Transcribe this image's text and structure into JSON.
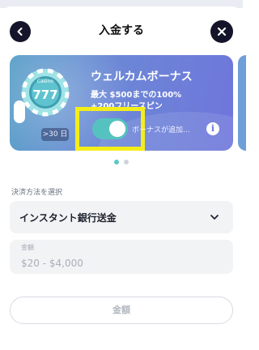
{
  "header": {
    "title": "入金する",
    "back_icon": "chevron-left-icon",
    "close_icon": "close-icon"
  },
  "bonus_card": {
    "chip_label": "Casino",
    "chip_number": "777",
    "days_badge": ">30 日",
    "title": "ウェルカムボーナス",
    "line1": "最大 $500までの100%",
    "line2": "+200フリースピン",
    "toggle_on": true,
    "toggle_label": "ボーナスが追加...",
    "info_icon": "info-icon"
  },
  "carousel": {
    "pages": 2,
    "active_index": 0
  },
  "payment": {
    "section_label": "決済方法を選択",
    "method_value": "インスタント銀行送金"
  },
  "amount": {
    "label": "金額",
    "placeholder": "$20 - $4,000"
  },
  "submit": {
    "label": "金額"
  },
  "colors": {
    "accent": "#55c2bf",
    "highlight": "#f3ee1a",
    "dark_button": "#14152a"
  }
}
